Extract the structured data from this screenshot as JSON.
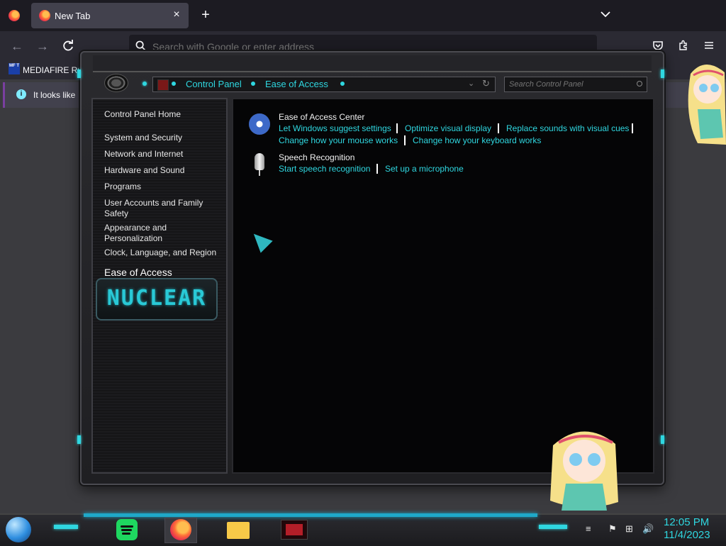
{
  "browser": {
    "tab_title": "New Tab",
    "tab_close_icon": "×",
    "new_tab_icon": "+",
    "address_placeholder": "Search with Google or enter address",
    "bookmark_label": "MEDIAFIRE RO",
    "bookmark_favicon_text": "MF T",
    "notice_text": "It looks like"
  },
  "control_panel": {
    "breadcrumbs": [
      "Control Panel",
      "Ease of Access"
    ],
    "search_placeholder": "Search Control Panel",
    "sidebar_items": [
      "Control Panel Home",
      "System and Security",
      "Network and Internet",
      "Hardware and Sound",
      "Programs",
      "User Accounts and Family Safety",
      "Appearance and Personalization",
      "Clock, Language, and Region"
    ],
    "sidebar_active": "Ease of Access",
    "theme_logo_text": "NUCLEAR",
    "categories": [
      {
        "title": "Ease of Access Center",
        "links": [
          "Let Windows suggest settings",
          "Optimize visual display",
          "Replace sounds with visual cues",
          "Change how your mouse works",
          "Change how your keyboard works"
        ]
      },
      {
        "title": "Speech Recognition",
        "links": [
          "Start speech recognition",
          "Set up a microphone"
        ]
      }
    ]
  },
  "taskbar": {
    "time": "12:05 PM",
    "date": "11/4/2023"
  },
  "colors": {
    "accent_cyan": "#2fd7e0",
    "browser_bg": "#1c1b22",
    "window_bg": "#050506"
  }
}
